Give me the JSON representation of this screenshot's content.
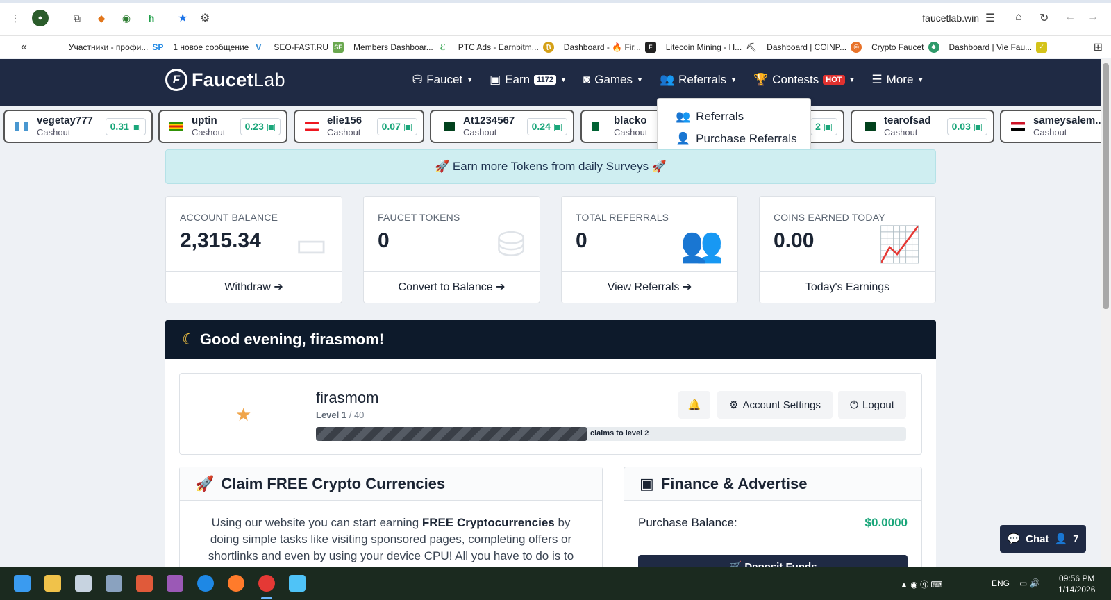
{
  "browser": {
    "url": "faucetlab.win",
    "bookmarks": [
      {
        "label": "Участники - профи...",
        "icon_color": "#1e88e5"
      },
      {
        "label": "1 новое сообщение",
        "icon_color": "#3b8fd6"
      },
      {
        "label": "SEO-FAST.RU",
        "icon_color": "#4a90e2"
      },
      {
        "label": "Members Dashboar...",
        "icon_color": "#3aa655"
      },
      {
        "label": "PTC Ads - Earnbitm...",
        "icon_color": "#4a5bd4"
      },
      {
        "label": "Dashboard - 🔥 Fir...",
        "icon_color": "#d4a017"
      },
      {
        "label": "Litecoin Mining - H...",
        "icon_color": "#222222"
      },
      {
        "label": "Dashboard | COINP...",
        "icon_color": "#555555"
      },
      {
        "label": "Crypto Faucet",
        "icon_color": "#e8732a"
      },
      {
        "label": "Dashboard | Vie Fau...",
        "icon_color": "#2e9a6a"
      }
    ]
  },
  "site": {
    "logo_main": "Faucet",
    "logo_sub": "Lab",
    "nav": {
      "faucet": "Faucet",
      "earn": "Earn",
      "earn_badge": "1172",
      "games": "Games",
      "referrals": "Referrals",
      "contests": "Contests",
      "contests_badge": "HOT",
      "more": "More"
    },
    "dropdown": {
      "item1": "Referrals",
      "item2": "Purchase Referrals"
    }
  },
  "ticker": [
    {
      "name": "vegetay777",
      "sub": "Cashout",
      "amount": "0.31",
      "flag": "gt"
    },
    {
      "name": "uptin",
      "sub": "Cashout",
      "amount": "0.23",
      "flag": "zw"
    },
    {
      "name": "elie156",
      "sub": "Cashout",
      "amount": "0.07",
      "flag": "lb"
    },
    {
      "name": "At1234567",
      "sub": "Cashout",
      "amount": "0.24",
      "flag": "pk"
    },
    {
      "name": "blacko",
      "sub": "Cashout",
      "amount": "",
      "flag": "dz"
    },
    {
      "name": "",
      "sub": "",
      "amount": "2",
      "flag": ""
    },
    {
      "name": "tearofsad",
      "sub": "Cashout",
      "amount": "0.03",
      "flag": "pk"
    },
    {
      "name": "sameysalem..",
      "sub": "Cashout",
      "amount": "",
      "flag": "eg"
    }
  ],
  "alert": "🚀 Earn more Tokens from daily Surveys 🚀",
  "stats": [
    {
      "label": "ACCOUNT BALANCE",
      "value": "2,315.34",
      "footer": "Withdraw",
      "icon": "wallet-icon"
    },
    {
      "label": "FAUCET TOKENS",
      "value": "0",
      "footer": "Convert to Balance",
      "icon": "coins-icon"
    },
    {
      "label": "TOTAL REFERRALS",
      "value": "0",
      "footer": "View Referrals",
      "icon": "users-icon"
    },
    {
      "label": "COINS EARNED TODAY",
      "value": "0.00",
      "footer": "Today's Earnings",
      "icon": "chart-line-icon"
    }
  ],
  "greeting": "Good evening, firasmom!",
  "profile": {
    "username": "firasmom",
    "level_label": "Level 1",
    "level_max": "/ 40",
    "progress_text": "claims to level 2",
    "progress_fraction": 0.46,
    "bell": "",
    "settings": "Account Settings",
    "logout": "Logout"
  },
  "claim_card": {
    "title": "Claim FREE Crypto Currencies",
    "text_pre": "Using our website you can start earning ",
    "text_bold": "FREE Cryptocurrencies",
    "text_post": " by doing simple tasks like visiting sponsored pages, completing offers or shortlinks and even by using your device CPU! All you have to do is to"
  },
  "finance_card": {
    "title": "Finance & Advertise",
    "balance_label": "Purchase Balance:",
    "balance_value": "$0.0000",
    "deposit_label": "Deposit Funds"
  },
  "chat": {
    "label": "Chat",
    "count": "7"
  },
  "taskbar": {
    "lang": "ENG",
    "time": "09:56 PM",
    "date": "1/14/2026"
  },
  "colors": {
    "navbar": "#1f2a44",
    "accent_green": "#1aa67a",
    "hot_badge": "#e0312f",
    "greeting_bg": "#0d1a2b"
  }
}
